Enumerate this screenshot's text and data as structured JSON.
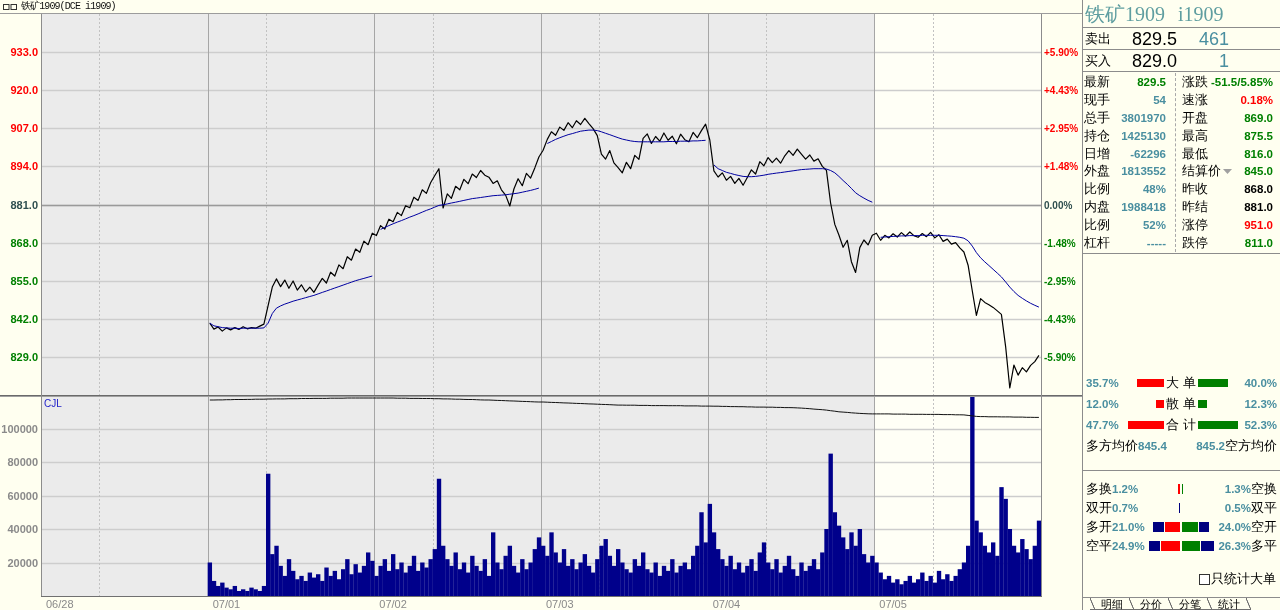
{
  "title_bar": {
    "title": "铁矿1909(DCE i1909)"
  },
  "price_panel": {
    "percent_labels": [
      {
        "label": "+5.90%",
        "color": "#ff0000"
      },
      {
        "label": "+4.43%",
        "color": "#ff0000"
      },
      {
        "label": "+2.95%",
        "color": "#ff0000"
      },
      {
        "label": "+1.48%",
        "color": "#ff0000"
      },
      {
        "label": "0.00%",
        "color": "#2f4f4f"
      },
      {
        "label": "-1.48%",
        "color": "#008000"
      },
      {
        "label": "-2.95%",
        "color": "#008000"
      },
      {
        "label": "-4.43%",
        "color": "#008000"
      },
      {
        "label": "-5.90%",
        "color": "#008000"
      }
    ],
    "chart_data": {
      "type": "line",
      "grid": true,
      "ylim": [
        816,
        946
      ],
      "yticks": [
        {
          "value": 933,
          "label": "933.0"
        },
        {
          "value": 920,
          "label": "920.0"
        },
        {
          "value": 907,
          "label": "907.0"
        },
        {
          "value": 894,
          "label": "894.0"
        },
        {
          "value": 881,
          "label": "881.0"
        },
        {
          "value": 868,
          "label": "868.0"
        },
        {
          "value": 855,
          "label": "855.0"
        },
        {
          "value": 842,
          "label": "842.0"
        },
        {
          "value": 829,
          "label": "829.0"
        }
      ],
      "ref_lines": [
        {
          "axis": "y",
          "value": 881
        }
      ],
      "series": [
        {
          "color": "#000000",
          "values": [
            null,
            null,
            null,
            null,
            null,
            null,
            null,
            null,
            null,
            null,
            null,
            null,
            null,
            null,
            null,
            null,
            null,
            null,
            null,
            null,
            null,
            null,
            null,
            null,
            null,
            null,
            null,
            null,
            null,
            null,
            null,
            null,
            null,
            null,
            null,
            null,
            null,
            null,
            null,
            null,
            840.5,
            838.5,
            839.2,
            837.8,
            838.9,
            838.2,
            839.0,
            838.4,
            839.3,
            838.6,
            839.0,
            838.8,
            839.5,
            840.2,
            846.5,
            852.8,
            855.6,
            853.0,
            855.2,
            852.4,
            854.9,
            851.8,
            853.6,
            851.2,
            852.8,
            851.0,
            853.5,
            855.8,
            854.2,
            857.9,
            856.6,
            860.4,
            859.1,
            863.2,
            862.0,
            865.8,
            864.7,
            868.5,
            867.3,
            871.2,
            870.4,
            873.8,
            872.6,
            876.0,
            875.1,
            878.3,
            877.2,
            880.6,
            879.9,
            883.5,
            882.4,
            886.0,
            884.8,
            888.4,
            890.9,
            893.2,
            879.8,
            884.6,
            883.1,
            887.2,
            886.0,
            889.6,
            888.1,
            891.4,
            890.2,
            892.6,
            891.0,
            890.3,
            888.2,
            889.1,
            886.0,
            884.2,
            880.5,
            886.3,
            889.8,
            887.4,
            891.6,
            890.0,
            893.5,
            897.2,
            899.5,
            903.2,
            905.8,
            904.6,
            907.4,
            906.3,
            908.9,
            907.2,
            909.6,
            908.3,
            910.4,
            908.6,
            906.9,
            904.5,
            898.2,
            896.5,
            899.4,
            895.2,
            893.6,
            891.8,
            895.4,
            893.2,
            897.8,
            896.4,
            903.6,
            905.1,
            901.8,
            904.2,
            902.6,
            905.4,
            902.9,
            904.3,
            901.7,
            905.0,
            903.1,
            902.4,
            905.6,
            903.8,
            906.2,
            908.4,
            903.0,
            892.5,
            890.4,
            891.8,
            889.3,
            890.6,
            888.2,
            889.9,
            887.6,
            890.2,
            892.8,
            891.4,
            895.6,
            894.2,
            897.0,
            895.3,
            896.8,
            895.1,
            897.6,
            899.4,
            897.8,
            899.9,
            898.2,
            896.5,
            897.9,
            895.8,
            896.6,
            894.0,
            892.7,
            881.5,
            874.2,
            870.6,
            866.4,
            868.8,
            861.5,
            857.8,
            866.3,
            868.9,
            867.2,
            870.5,
            871.2,
            868.8,
            870.5,
            869.6,
            871.0,
            869.9,
            871.4,
            870.2,
            871.6,
            870.4,
            869.8,
            871.1,
            870.0,
            871.5,
            869.6,
            870.7,
            868.4,
            869.2,
            867.5,
            868.0,
            866.2,
            864.8,
            860.3,
            851.5,
            843.2,
            848.9,
            847.6,
            846.8,
            845.9,
            844.7,
            843.5,
            832.6,
            818.4,
            826.2,
            822.8,
            825.3,
            823.9,
            826.1,
            827.4,
            829.5
          ]
        },
        {
          "color": "#0000a0",
          "values": [
            null,
            null,
            null,
            null,
            null,
            null,
            null,
            null,
            null,
            null,
            null,
            null,
            null,
            null,
            null,
            null,
            null,
            null,
            null,
            null,
            null,
            null,
            null,
            null,
            null,
            null,
            null,
            null,
            null,
            null,
            null,
            null,
            null,
            null,
            null,
            null,
            null,
            null,
            null,
            null,
            840.5,
            839.6,
            839.3,
            839.0,
            838.9,
            838.8,
            838.8,
            838.7,
            838.8,
            838.8,
            838.8,
            838.8,
            838.8,
            838.9,
            840.5,
            843.8,
            845.6,
            846.4,
            847.0,
            847.5,
            848.0,
            848.4,
            848.8,
            849.2,
            849.6,
            850.0,
            850.5,
            851.0,
            851.5,
            852.0,
            852.5,
            853.0,
            853.5,
            854.0,
            854.5,
            855.0,
            855.4,
            855.8,
            856.2,
            856.6,
            null,
            872.5,
            873.2,
            873.8,
            874.4,
            875.0,
            875.5,
            876.1,
            876.7,
            877.2,
            877.8,
            878.4,
            879.0,
            879.5,
            880.1,
            880.7,
            880.9,
            881.2,
            881.5,
            881.8,
            882.1,
            882.4,
            882.7,
            883.0,
            883.2,
            883.4,
            883.6,
            883.8,
            884.0,
            884.1,
            884.2,
            884.3,
            884.5,
            884.7,
            884.9,
            885.2,
            885.5,
            885.8,
            886.2,
            886.6,
            null,
            901.8,
            902.5,
            903.2,
            903.8,
            904.3,
            904.8,
            905.2,
            905.6,
            906.0,
            906.2,
            906.4,
            906.4,
            906.2,
            905.8,
            905.3,
            904.8,
            904.3,
            903.8,
            903.3,
            903.0,
            902.7,
            902.5,
            902.4,
            902.4,
            902.4,
            902.4,
            902.4,
            902.4,
            902.4,
            902.5,
            902.5,
            902.5,
            902.6,
            902.6,
            902.6,
            902.7,
            902.7,
            902.8,
            902.9,
            null,
            894.5,
            893.2,
            892.6,
            892.0,
            891.6,
            891.2,
            890.9,
            890.6,
            890.5,
            890.5,
            890.6,
            890.8,
            891.0,
            891.3,
            891.5,
            891.7,
            891.9,
            892.1,
            892.3,
            892.5,
            892.7,
            892.9,
            893.0,
            893.1,
            893.2,
            893.2,
            893.2,
            893.1,
            892.6,
            891.8,
            890.6,
            889.2,
            887.9,
            886.5,
            885.0,
            884.0,
            883.2,
            882.4,
            881.8,
            null,
            869.8,
            869.9,
            870.0,
            870.1,
            870.2,
            870.3,
            870.3,
            870.4,
            870.4,
            870.4,
            870.5,
            870.5,
            870.5,
            870.5,
            870.5,
            870.4,
            870.3,
            870.2,
            870.0,
            869.8,
            869.5,
            868.6,
            866.8,
            864.6,
            862.8,
            861.4,
            860.2,
            858.9,
            857.6,
            856.3,
            854.6,
            852.8,
            851.3,
            850.0,
            849.0,
            848.1,
            847.3,
            846.6,
            846.0
          ]
        }
      ]
    }
  },
  "volume_panel": {
    "label": "CJL",
    "chart_data": {
      "type": "bar",
      "grid": true,
      "ylim": [
        0,
        120000
      ],
      "yticks": [
        100000,
        80000,
        60000,
        40000,
        20000
      ],
      "categories": [
        null,
        null,
        null,
        null,
        "06/28",
        null,
        null,
        null,
        null,
        null,
        null,
        null,
        null,
        null,
        null,
        null,
        null,
        null,
        null,
        null,
        null,
        null,
        null,
        null,
        null,
        null,
        null,
        null,
        null,
        null,
        null,
        null,
        null,
        null,
        null,
        null,
        null,
        null,
        null,
        null,
        null,
        null,
        null,
        null,
        "07/01",
        null,
        null,
        null,
        null,
        null,
        null,
        null,
        null,
        null,
        null,
        null,
        null,
        null,
        null,
        null,
        null,
        null,
        null,
        null,
        null,
        null,
        null,
        null,
        null,
        null,
        null,
        null,
        null,
        null,
        null,
        null,
        null,
        null,
        null,
        null,
        null,
        null,
        null,
        null,
        "07/02",
        null,
        null,
        null,
        null,
        null,
        null,
        null,
        null,
        null,
        null,
        null,
        null,
        null,
        null,
        null,
        null,
        null,
        null,
        null,
        null,
        null,
        null,
        null,
        null,
        null,
        null,
        null,
        null,
        null,
        null,
        null,
        null,
        null,
        null,
        null,
        null,
        null,
        null,
        null,
        "07/03",
        null,
        null,
        null,
        null,
        null,
        null,
        null,
        null,
        null,
        null,
        null,
        null,
        null,
        null,
        null,
        null,
        null,
        null,
        null,
        null,
        null,
        null,
        null,
        null,
        null,
        null,
        null,
        null,
        null,
        null,
        null,
        null,
        null,
        null,
        null,
        null,
        null,
        null,
        null,
        "07/04",
        null,
        null,
        null,
        null,
        null,
        null,
        null,
        null,
        null,
        null,
        null,
        null,
        null,
        null,
        null,
        null,
        null,
        null,
        null,
        null,
        null,
        null,
        null,
        null,
        null,
        null,
        null,
        null,
        null,
        null,
        null,
        null,
        null,
        null,
        null,
        null,
        null,
        null,
        null,
        "07/05",
        null,
        null,
        null,
        null,
        null,
        null,
        null,
        null,
        null,
        null,
        null,
        null,
        null,
        null,
        null,
        null,
        null,
        null,
        null,
        null,
        null,
        null,
        null,
        null,
        null,
        null,
        null,
        null,
        null,
        null,
        null,
        null,
        null,
        null,
        null
      ],
      "series": [
        {
          "color": "#00008b",
          "values": [
            null,
            null,
            null,
            null,
            null,
            null,
            null,
            null,
            null,
            null,
            null,
            null,
            null,
            null,
            null,
            null,
            null,
            null,
            null,
            null,
            null,
            null,
            null,
            null,
            null,
            null,
            null,
            null,
            null,
            null,
            null,
            null,
            null,
            null,
            null,
            null,
            null,
            null,
            null,
            null,
            20000,
            9000,
            6000,
            8000,
            5000,
            4000,
            6000,
            3000,
            4000,
            3000,
            5000,
            4000,
            3000,
            6000,
            73000,
            25000,
            30000,
            18000,
            12000,
            22000,
            15000,
            10000,
            12000,
            9000,
            14000,
            11000,
            13000,
            9000,
            17000,
            12000,
            15000,
            10000,
            16000,
            22000,
            13000,
            19000,
            14000,
            18000,
            26000,
            21000,
            12000,
            18000,
            22000,
            15000,
            25000,
            16000,
            20000,
            14000,
            18000,
            24000,
            15000,
            20000,
            17000,
            22000,
            28000,
            70000,
            30000,
            22000,
            18000,
            26000,
            16000,
            20000,
            14000,
            24000,
            18000,
            15000,
            22000,
            12000,
            38000,
            20000,
            16000,
            24000,
            30000,
            18000,
            14000,
            22000,
            16000,
            20000,
            28000,
            35000,
            30000,
            24000,
            38000,
            26000,
            20000,
            28000,
            18000,
            22000,
            16000,
            20000,
            25000,
            18000,
            14000,
            22000,
            30000,
            34000,
            24000,
            18000,
            28000,
            20000,
            16000,
            14000,
            22000,
            18000,
            26000,
            16000,
            14000,
            20000,
            12000,
            18000,
            15000,
            22000,
            14000,
            18000,
            20000,
            16000,
            24000,
            30000,
            50000,
            32000,
            55000,
            38000,
            28000,
            22000,
            18000,
            24000,
            16000,
            20000,
            14000,
            18000,
            22000,
            15000,
            26000,
            32000,
            20000,
            16000,
            22000,
            14000,
            18000,
            24000,
            16000,
            12000,
            20000,
            15000,
            18000,
            22000,
            16000,
            26000,
            40000,
            85000,
            50000,
            42000,
            35000,
            28000,
            38000,
            30000,
            40000,
            25000,
            20000,
            24000,
            20000,
            14000,
            10000,
            12000,
            8000,
            10000,
            7000,
            9000,
            12000,
            8000,
            10000,
            14000,
            9000,
            12000,
            8000,
            15000,
            10000,
            13000,
            9000,
            12000,
            16000,
            20000,
            30000,
            119000,
            45000,
            38000,
            30000,
            26000,
            32000,
            24000,
            65000,
            58000,
            40000,
            30000,
            26000,
            34000,
            28000,
            22000,
            30000,
            45000
          ]
        },
        {
          "type": "line",
          "color": "#111111",
          "values": [
            null,
            null,
            null,
            null,
            null,
            null,
            null,
            null,
            null,
            null,
            null,
            null,
            null,
            null,
            null,
            null,
            null,
            null,
            null,
            null,
            null,
            null,
            null,
            null,
            null,
            null,
            null,
            null,
            null,
            null,
            null,
            null,
            null,
            null,
            null,
            null,
            null,
            null,
            null,
            null,
            117000,
            117000,
            117100,
            117100,
            117200,
            117200,
            117300,
            117300,
            117300,
            117400,
            117400,
            117500,
            117500,
            117500,
            117600,
            117600,
            117700,
            117700,
            117700,
            117800,
            117800,
            117800,
            117900,
            117900,
            117900,
            118000,
            118000,
            118000,
            118000,
            118100,
            118100,
            118100,
            118100,
            118200,
            118200,
            118200,
            118200,
            118200,
            118200,
            118200,
            118200,
            118200,
            118200,
            118200,
            118200,
            118100,
            118100,
            118100,
            118000,
            118000,
            118000,
            117900,
            117900,
            117900,
            117800,
            117800,
            117700,
            117700,
            117600,
            117500,
            117500,
            117400,
            117300,
            117300,
            117200,
            117100,
            117000,
            117000,
            116900,
            116800,
            116700,
            116600,
            116500,
            116400,
            116300,
            116200,
            116100,
            116000,
            115900,
            115800,
            115800,
            115700,
            115600,
            115500,
            115400,
            115300,
            115200,
            115100,
            115000,
            114900,
            114800,
            114700,
            114600,
            114500,
            114400,
            114300,
            114200,
            114100,
            114000,
            114000,
            113900,
            113900,
            113900,
            113800,
            113800,
            113800,
            113700,
            113700,
            113700,
            113700,
            113600,
            113600,
            113600,
            113600,
            113500,
            113500,
            113500,
            113500,
            113400,
            113400,
            113400,
            113300,
            113300,
            113200,
            113200,
            113100,
            113100,
            113000,
            113000,
            112900,
            112900,
            112800,
            112800,
            112800,
            112700,
            112700,
            112600,
            112600,
            112500,
            112500,
            112400,
            112300,
            112200,
            112000,
            111800,
            111600,
            111400,
            111200,
            111000,
            110600,
            110300,
            110000,
            109800,
            109600,
            109400,
            109200,
            109000,
            108900,
            108800,
            108700,
            108700,
            108700,
            108700,
            108700,
            108600,
            108600,
            108600,
            108600,
            108500,
            108500,
            108500,
            108500,
            108400,
            108400,
            108400,
            108400,
            108300,
            108300,
            108300,
            108200,
            108200,
            108100,
            107800,
            107500,
            107200,
            107100,
            107100,
            107000,
            107000,
            107000,
            106900,
            106900,
            106900,
            106800,
            106800,
            106800,
            106700,
            106700,
            106600,
            106600
          ]
        }
      ]
    }
  },
  "quote": {
    "name": "铁矿1909",
    "code": "i1909",
    "ask": {
      "label": "卖出",
      "price": "829.5",
      "volume": "461"
    },
    "bid": {
      "label": "买入",
      "price": "829.0",
      "volume": "1"
    },
    "stats_left": [
      {
        "label": "最新",
        "value": "829.5",
        "color": "#008000"
      },
      {
        "label": "现手",
        "value": "54",
        "color": "#4a8fa0"
      },
      {
        "label": "总手",
        "value": "3801970",
        "color": "#4a8fa0"
      },
      {
        "label": "持仓",
        "value": "1425130",
        "color": "#4a8fa0"
      },
      {
        "label": "日增",
        "value": "-62296",
        "color": "#4a8fa0"
      },
      {
        "label": "外盘",
        "value": "1813552",
        "color": "#4a8fa0"
      },
      {
        "label": "比例",
        "value": "48%",
        "color": "#4a8fa0"
      },
      {
        "label": "内盘",
        "value": "1988418",
        "color": "#4a8fa0"
      },
      {
        "label": "比例",
        "value": "52%",
        "color": "#4a8fa0"
      },
      {
        "label": "杠杆",
        "value": "-----",
        "color": "#4a8fa0"
      }
    ],
    "stats_right": [
      {
        "label": "涨跌",
        "value": "-51.5/5.85%",
        "color": "#008000",
        "menu": false
      },
      {
        "label": "速涨",
        "value": "0.18%",
        "color": "#ff0000",
        "menu": false
      },
      {
        "label": "开盘",
        "value": "869.0",
        "color": "#008000",
        "menu": false
      },
      {
        "label": "最高",
        "value": "875.5",
        "color": "#008000",
        "menu": false
      },
      {
        "label": "最低",
        "value": "816.0",
        "color": "#008000",
        "menu": false
      },
      {
        "label": "结算价",
        "value": "845.0",
        "color": "#008000",
        "menu": true
      },
      {
        "label": "昨收",
        "value": "868.0",
        "color": "#000000",
        "menu": false
      },
      {
        "label": "昨结",
        "value": "881.0",
        "color": "#000000",
        "menu": false
      },
      {
        "label": "涨停",
        "value": "951.0",
        "color": "#ff0000",
        "menu": false
      },
      {
        "label": "跌停",
        "value": "811.0",
        "color": "#008000",
        "menu": false
      }
    ]
  },
  "order_stats": {
    "rows": [
      {
        "buy": "35.7%",
        "label": "大 单",
        "sell": "40.0%"
      },
      {
        "buy": "12.0%",
        "label": "散 单",
        "sell": "12.3%"
      },
      {
        "buy": "47.7%",
        "label": "合 计",
        "sell": "52.3%"
      }
    ],
    "long_avg": {
      "label": "多方均价",
      "value": "845.4"
    },
    "short_avg": {
      "label": "空方均价",
      "value": "845.2"
    }
  },
  "position_changes": {
    "rows": [
      {
        "left_label": "多换",
        "left_value": "1.2%",
        "right_value": "1.3%",
        "right_label": "空换"
      },
      {
        "left_label": "双开",
        "left_value": "0.7%",
        "right_value": "0.5%",
        "right_label": "双平"
      },
      {
        "left_label": "多开",
        "left_value": "21.0%",
        "right_value": "24.0%",
        "right_label": "空开"
      },
      {
        "left_label": "空平",
        "left_value": "24.9%",
        "right_value": "26.3%",
        "right_label": "多平"
      }
    ]
  },
  "filter": {
    "label": "只统计大单",
    "checked": false
  },
  "tabs": [
    {
      "label": "明细",
      "selected": false
    },
    {
      "label": "分价",
      "selected": false
    },
    {
      "label": "分笔",
      "selected": false
    },
    {
      "label": "统计",
      "selected": false
    }
  ]
}
